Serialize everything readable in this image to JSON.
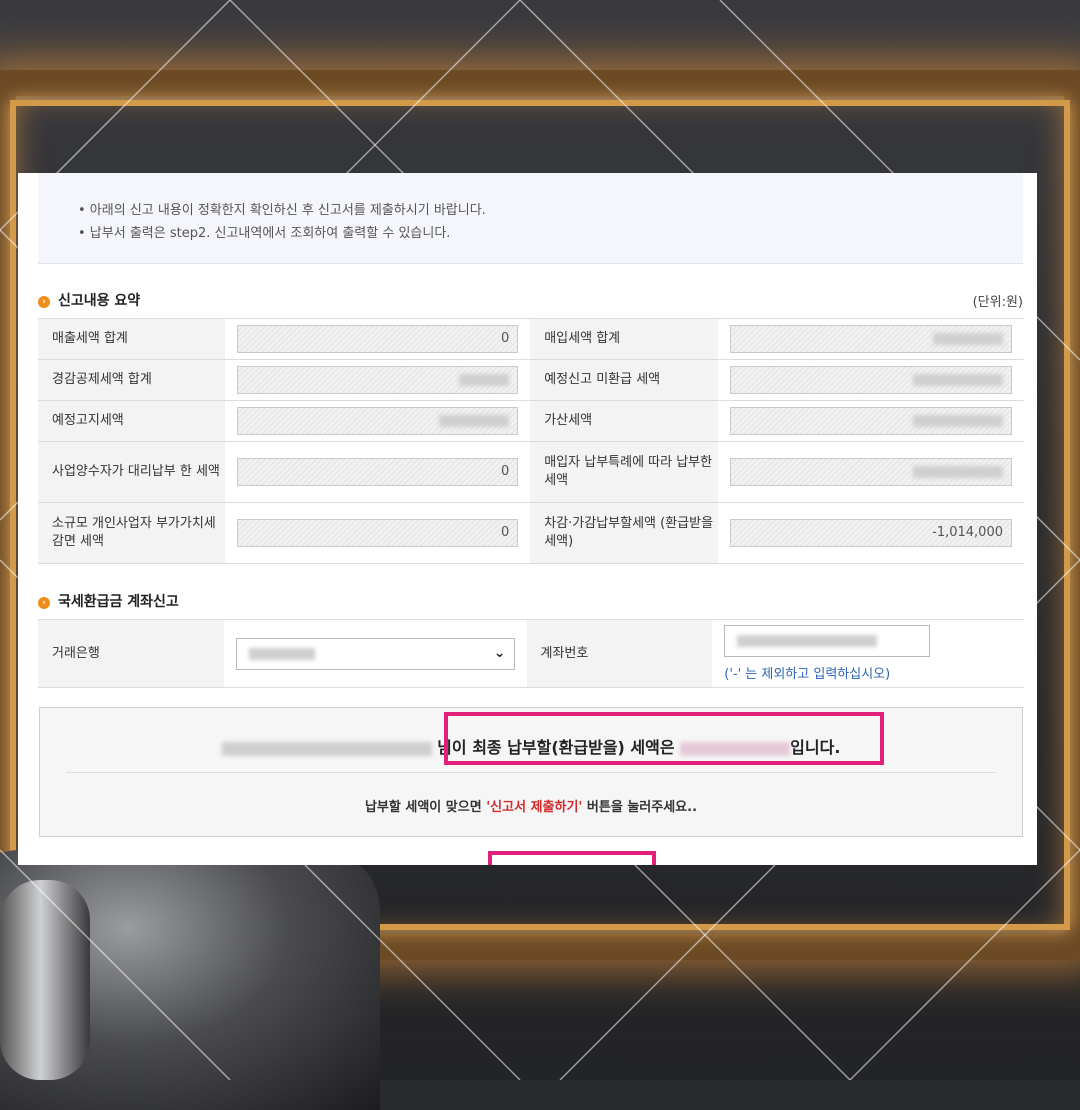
{
  "notice": {
    "line1": "• 아래의 신고 내용이 정확한지 확인하신 후 신고서를 제출하시기 바랍니다.",
    "line2": "• 납부서 출력은 step2. 신고내역에서 조회하여 출력할 수 있습니다."
  },
  "summary": {
    "title": "신고내용 요약",
    "unit": "(단위:원)",
    "rows": [
      {
        "l1": "매출세액 합계",
        "v1": "0",
        "l2": "매입세액 합계",
        "v2": ""
      },
      {
        "l1": "경감공제세액 합계",
        "v1": "",
        "l2": "예정신고 미환급 세액",
        "v2": ""
      },
      {
        "l1": "예정고지세액",
        "v1": "",
        "l2": "가산세액",
        "v2": ""
      },
      {
        "l1": "사업양수자가 대리납부 한 세액",
        "v1": "0",
        "l2": "매입자 납부특례에 따라 납부한 세액",
        "v2": ""
      },
      {
        "l1": "소규모 개인사업자 부가가치세 감면 세액",
        "v1": "0",
        "l2": "차감·가감납부할세액 (환급받을세액)",
        "v2": "-1,014,000"
      }
    ]
  },
  "account": {
    "title": "국세환급금 계좌신고",
    "bank_label": "거래은행",
    "account_label": "계좌번호",
    "hint": "('-' 는 제외하고 입력하십시오)"
  },
  "result": {
    "suffix_name": "님이",
    "final_text": "최종 납부할(환급받을) 세액은",
    "end_text": "입니다.",
    "guide_prefix": "납부할 세액이 맞으면 ",
    "guide_button": "'신고서 제출하기'",
    "guide_suffix": " 버튼을 눌러주세요.."
  },
  "colors": {
    "highlight": "#e0207a",
    "accent": "#f08c1a",
    "link": "#2b63b6",
    "emphasis": "#d32b2b"
  }
}
